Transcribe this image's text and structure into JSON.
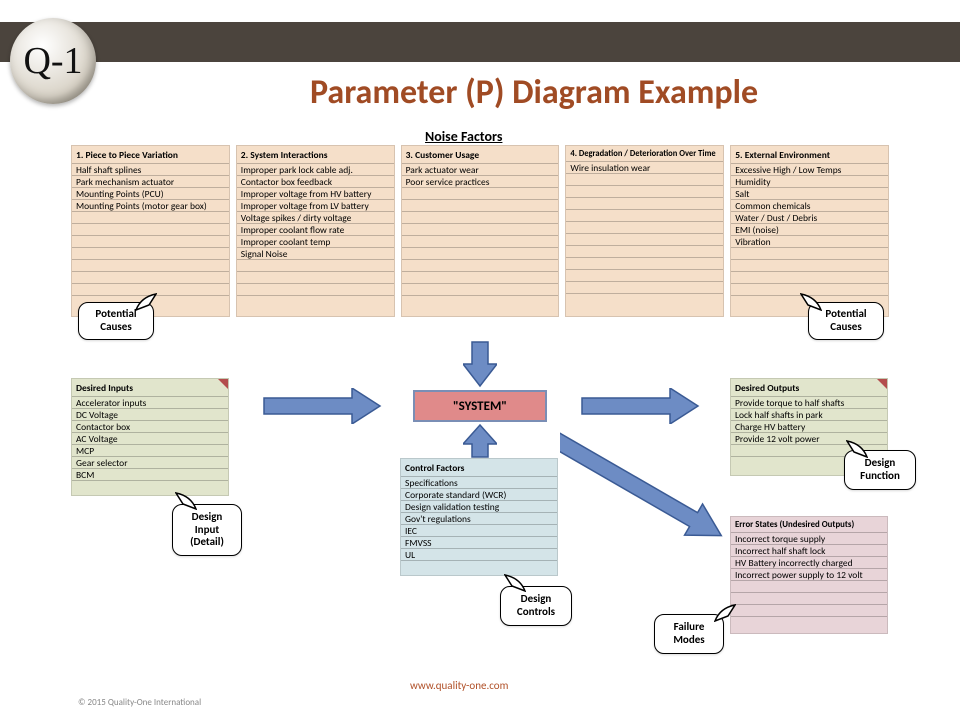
{
  "logo_text": "Q-1",
  "title": "Parameter (P) Diagram Example",
  "noise_title": "Noise Factors",
  "system_label": "\"SYSTEM\"",
  "footer_url": "www.quality-one.com",
  "footer_cpy": "© 2015 Quality-One International",
  "noise": [
    {
      "header": "1. Piece to Piece Variation",
      "items": [
        "Half shaft splines",
        "Park mechanism actuator",
        "Mounting Points (PCU)",
        "Mounting Points (motor gear box)"
      ]
    },
    {
      "header": "2. System Interactions",
      "items": [
        "Improper park lock cable adj.",
        "Contactor box feedback",
        "Improper voltage from HV battery",
        "Improper voltage from LV battery",
        "Voltage spikes / dirty voltage",
        "Improper coolant flow rate",
        "Improper coolant temp",
        "Signal Noise"
      ]
    },
    {
      "header": "3. Customer Usage",
      "items": [
        "Park actuator wear",
        "Poor service practices"
      ]
    },
    {
      "header": "4. Degradation / Deterioration Over Time",
      "items": [
        "Wire insulation wear"
      ]
    },
    {
      "header": "5. External Environment",
      "items": [
        "Excessive High / Low Temps",
        "Humidity",
        "Salt",
        "Common chemicals",
        "Water / Dust / Debris",
        "EMI (noise)",
        "Vibration"
      ]
    }
  ],
  "inputs": {
    "header": "Desired Inputs",
    "items": [
      "Accelerator inputs",
      "DC Voltage",
      "Contactor box",
      "AC Voltage",
      "MCP",
      "Gear selector",
      "BCM"
    ]
  },
  "control": {
    "header": "Control Factors",
    "items": [
      "Specifications",
      "Corporate standard (WCR)",
      "Design validation testing",
      "Gov't regulations",
      "IEC",
      "FMVSS",
      "UL"
    ]
  },
  "outputs": {
    "header": "Desired Outputs",
    "items": [
      "Provide torque to half shafts",
      "Lock half shafts in park",
      "Charge HV battery",
      "Provide 12 volt power"
    ]
  },
  "errors": {
    "header": "Error States (Undesired Outputs)",
    "items": [
      "Incorrect torque supply",
      "Incorrect half shaft lock",
      "HV Battery incorrectly charged",
      "Incorrect power supply to 12 volt"
    ]
  },
  "callouts": {
    "potential_causes": "Potential\nCauses",
    "design_input": "Design\nInput\n(Detail)",
    "design_controls": "Design\nControls",
    "design_function": "Design\nFunction",
    "failure_modes": "Failure\nModes"
  }
}
